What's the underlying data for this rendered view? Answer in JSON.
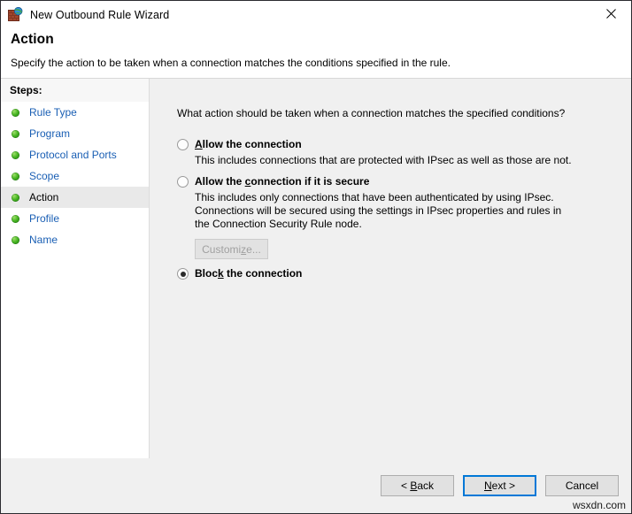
{
  "window": {
    "title": "New Outbound Rule Wizard",
    "icon": "firewall-globe-icon",
    "close_label": "✕"
  },
  "header": {
    "title": "Action",
    "subtitle": "Specify the action to be taken when a connection matches the conditions specified in the rule."
  },
  "sidebar": {
    "heading": "Steps:",
    "items": [
      {
        "label": "Rule Type",
        "current": false
      },
      {
        "label": "Program",
        "current": false
      },
      {
        "label": "Protocol and Ports",
        "current": false
      },
      {
        "label": "Scope",
        "current": false
      },
      {
        "label": "Action",
        "current": true
      },
      {
        "label": "Profile",
        "current": false
      },
      {
        "label": "Name",
        "current": false
      }
    ]
  },
  "main": {
    "question": "What action should be taken when a connection matches the specified conditions?",
    "options": [
      {
        "id": "allow",
        "title_pre": "",
        "title_accel": "A",
        "title_post": "llow the connection",
        "title_full": "Allow the connection",
        "description": "This includes connections that are protected with IPsec as well as those are not.",
        "selected": false
      },
      {
        "id": "allow-secure",
        "title_pre": "Allow the ",
        "title_accel": "c",
        "title_post": "onnection if it is secure",
        "title_full": "Allow the connection if it is secure",
        "description": "This includes only connections that have been authenticated by using IPsec.  Connections will be secured using the settings in IPsec properties and rules in the Connection Security Rule node.",
        "selected": false,
        "button": {
          "label": "Customize...",
          "label_pre": "Customi",
          "label_accel": "z",
          "label_post": "e...",
          "disabled": true
        }
      },
      {
        "id": "block",
        "title_pre": "Bloc",
        "title_accel": "k",
        "title_post": " the connection",
        "title_full": "Block the connection",
        "description": "",
        "selected": true
      }
    ]
  },
  "footer": {
    "back": {
      "pre": "< ",
      "accel": "B",
      "post": "ack",
      "full": "< Back"
    },
    "next": {
      "pre": "",
      "accel": "N",
      "post": "ext >",
      "full": "Next >"
    },
    "cancel": {
      "full": "Cancel"
    }
  },
  "watermark": "wsxdn.com",
  "colors": {
    "accent": "#0078d7",
    "link": "#1a5fb4",
    "panel": "#f0f0f0",
    "step_bullet": "#45b321"
  }
}
